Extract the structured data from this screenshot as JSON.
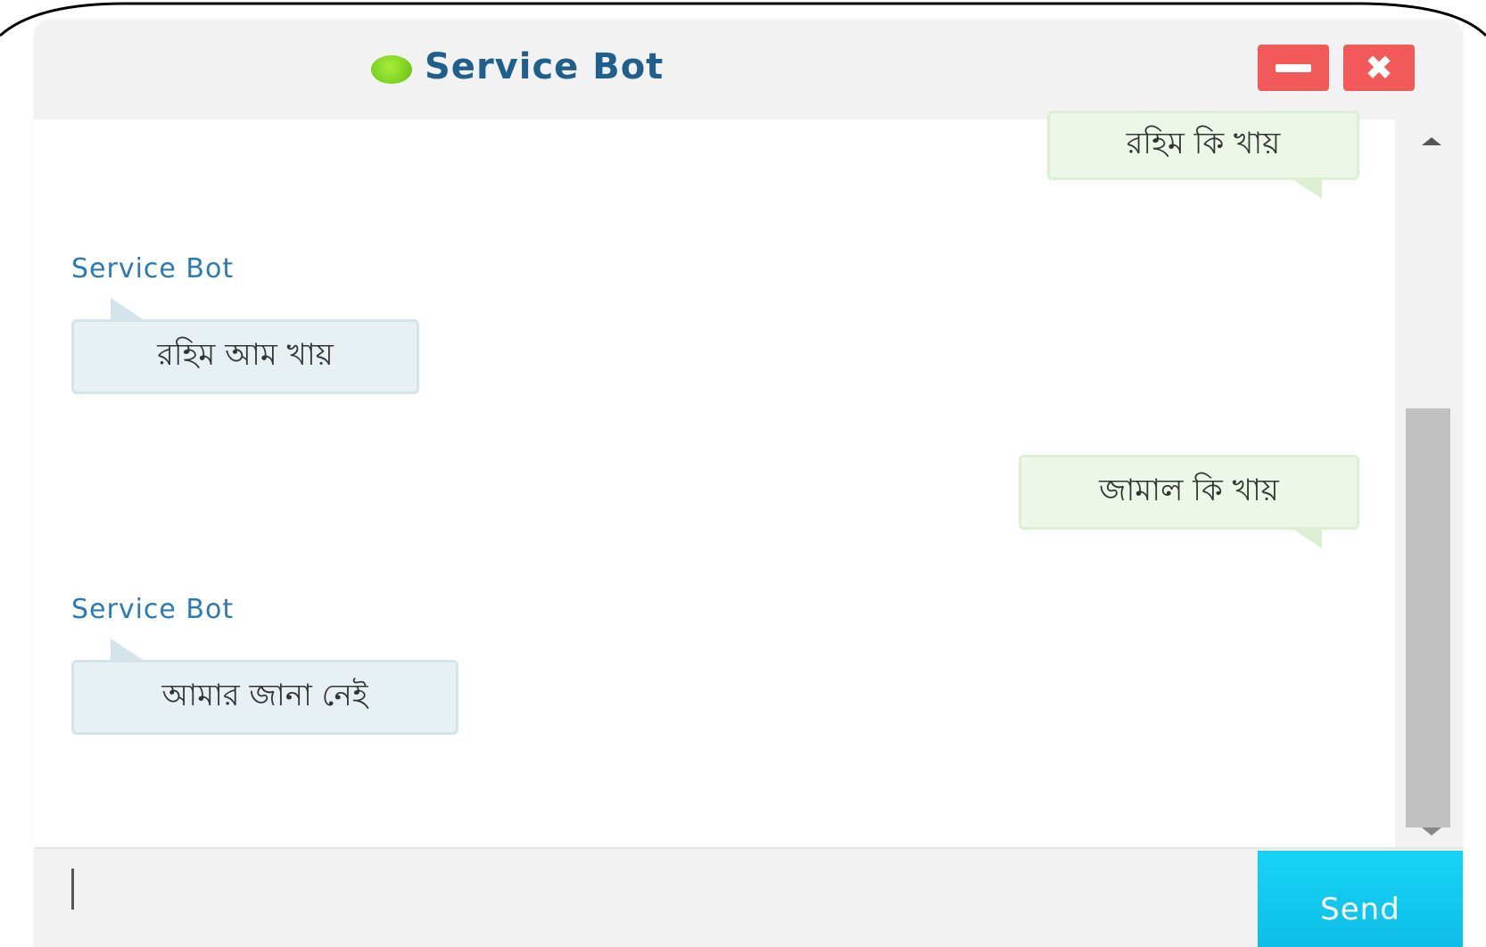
{
  "header": {
    "title": "Service Bot",
    "status": "online",
    "status_color": "#7ed321",
    "minimize_icon": "minimize-icon",
    "close_icon": "close-icon",
    "close_glyph": "✖",
    "button_color": "#f25a5a"
  },
  "messages": [
    {
      "from": "user",
      "text": "রহিম কি খায়"
    },
    {
      "from": "bot",
      "sender": "Service Bot",
      "text": "রহিম আম খায়"
    },
    {
      "from": "user",
      "text": "জামাল কি খায়"
    },
    {
      "from": "bot",
      "sender": "Service Bot",
      "text": "আমার জানা নেই"
    }
  ],
  "composer": {
    "value": "",
    "placeholder": "",
    "send_label": "Send",
    "send_color": "#0ebde6"
  }
}
